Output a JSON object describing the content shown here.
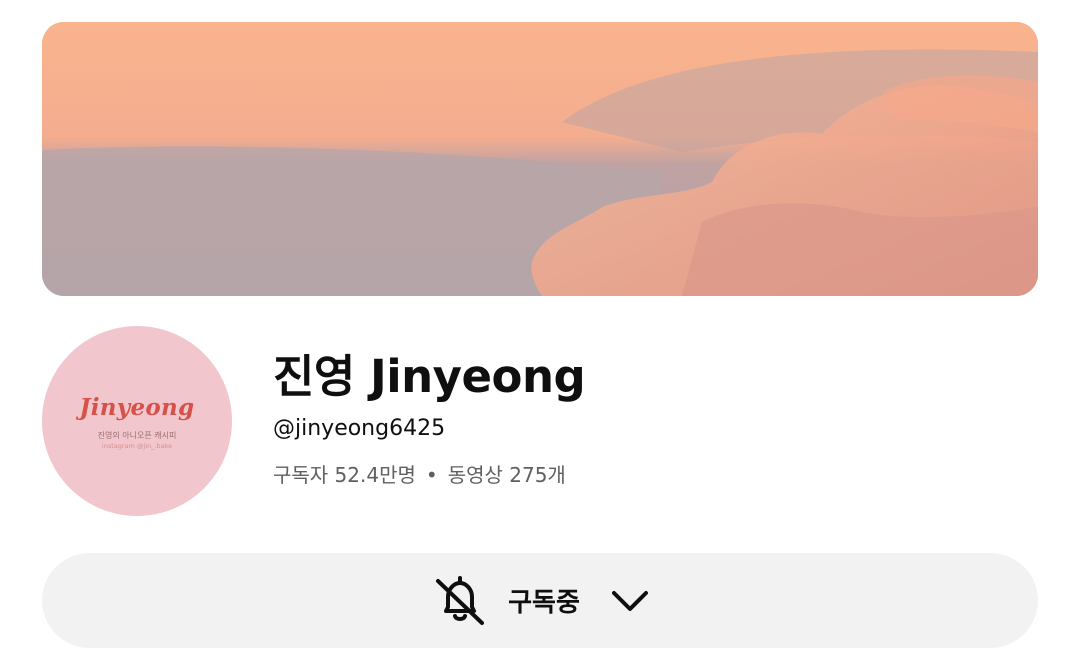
{
  "channel": {
    "name": "진영 Jinyeong",
    "handle": "@jinyeong6425",
    "subscribers": "구독자 52.4만명",
    "separator": "•",
    "videos": "동영상 275개"
  },
  "avatar": {
    "logo_text": "Jinyeong",
    "subtitle": "진영의 아니오픈 캐시피",
    "subtitle2": "instagram @jin_.bake"
  },
  "subscribe": {
    "label": "구독중",
    "icons": [
      "bell-off-icon",
      "chevron-down-icon"
    ]
  },
  "colors": {
    "avatar_bg": "#f1c6cc",
    "logo_red": "#d6514a",
    "button_bg": "#f2f2f2"
  }
}
